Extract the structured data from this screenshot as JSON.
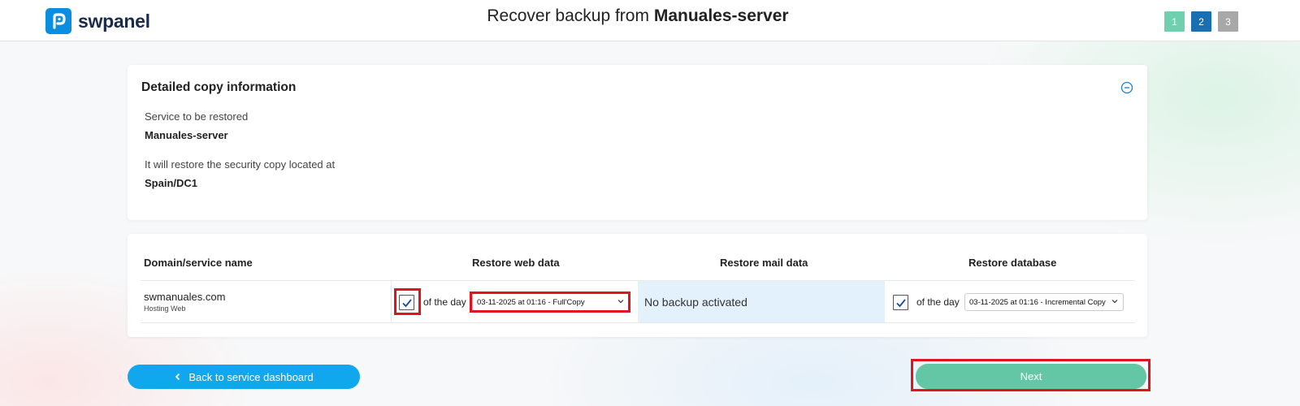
{
  "app": {
    "brand": "swpanel",
    "brand_color": "#0a8fe0"
  },
  "header": {
    "title_prefix": "Recover backup from",
    "title_server": "Manuales-server",
    "steps": [
      {
        "label": "1",
        "state": "done",
        "color": "#6fd0b0"
      },
      {
        "label": "2",
        "state": "current",
        "color": "#1a6fb3"
      },
      {
        "label": "3",
        "state": "pending",
        "color": "#a8a8a8"
      }
    ]
  },
  "info_card": {
    "title": "Detailed copy information",
    "collapse_icon": "minus-circle-icon",
    "service_label": "Service to be restored",
    "service_value": "Manuales-server",
    "location_label": "It will restore the security copy located at",
    "location_value": "Spain/DC1"
  },
  "restore_table": {
    "headers": {
      "domain": "Domain/service name",
      "web": "Restore web data",
      "mail": "Restore mail data",
      "db": "Restore database"
    },
    "rows": [
      {
        "domain": "swmanuales.com",
        "type": "Hosting Web",
        "web": {
          "checked": true,
          "of_day_label": "of the day",
          "selected": "03-11-2025 at 01:16 - Full'Copy"
        },
        "mail": {
          "status": "No backup activated"
        },
        "db": {
          "checked": true,
          "of_day_label": "of the day",
          "selected": "03-11-2025 at 01:16 - Incremental Copy"
        }
      }
    ]
  },
  "actions": {
    "back_label": "Back to service dashboard",
    "back_icon": "chevron-left-icon",
    "next_label": "Next"
  },
  "colors": {
    "highlight": "#e0141e",
    "primary": "#10a7ef",
    "success": "#63c7a6",
    "mail_cell": "#e2f1fc"
  }
}
